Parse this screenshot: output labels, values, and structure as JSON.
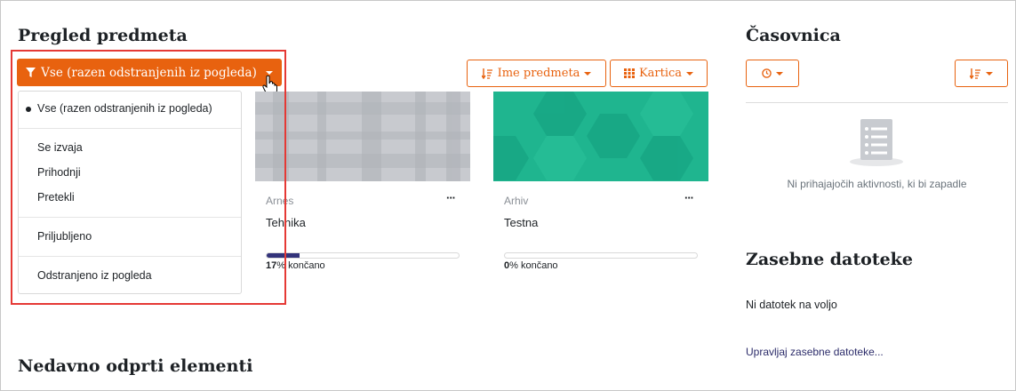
{
  "course_overview": {
    "title": "Pregled predmeta",
    "filter_button": "Vse (razen odstranjenih iz pogleda)",
    "sort_button": "Ime predmeta",
    "view_button": "Kartica",
    "dropdown": {
      "all": "Vse (razen odstranjenih iz pogleda)",
      "in_progress": "Se izvaja",
      "future": "Prihodnji",
      "past": "Pretekli",
      "starred": "Priljubljeno",
      "removed": "Odstranjeno iz pogleda"
    },
    "courses": [
      {
        "category": "Arnes",
        "name": "Tehnika",
        "progress": 17,
        "progress_text": "% končano",
        "image_color": "#c4c7cc"
      },
      {
        "category": "Arhiv",
        "name": "Testna",
        "progress": 0,
        "progress_text": "% končano",
        "image_color": "#1fb58f"
      }
    ]
  },
  "timeline": {
    "title": "Časovnica",
    "empty_text": "Ni prihajajočih aktivnosti, ki bi zapadle"
  },
  "private_files": {
    "title": "Zasebne datoteke",
    "empty_text": "Ni datotek na voljo",
    "manage_link": "Upravljaj zasebne datoteke..."
  },
  "recent_items": {
    "title": "Nedavno odprti elementi"
  },
  "colors": {
    "accent": "#e8620f",
    "progress": "#33337a",
    "highlight": "#e53935"
  }
}
